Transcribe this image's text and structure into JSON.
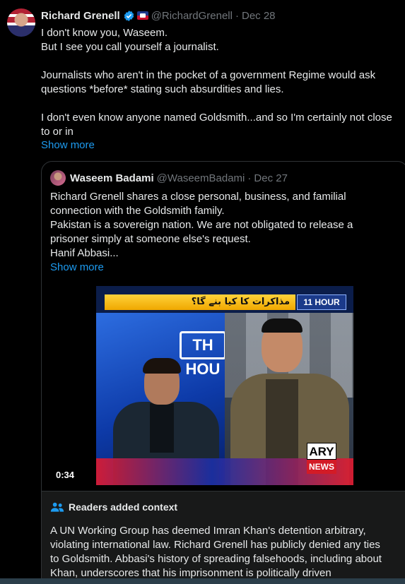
{
  "tweet": {
    "author_name": "Richard Grenell",
    "author_handle": "@RichardGrenell",
    "separator": "·",
    "date": "Dec 28",
    "lines": [
      "I don't know you, Waseem.",
      "But I see you call yourself a journalist.",
      "",
      "Journalists who aren't in the pocket of a government Regime would ask",
      "questions *before* stating such absurdities and lies.",
      "",
      "I don't even know anyone named Goldsmith...and so I'm certainly not close",
      "to or in"
    ],
    "show_more": "Show more"
  },
  "quote": {
    "author_name": "Waseem Badami",
    "author_handle": "@WaseemBadami",
    "separator": "·",
    "date": "Dec 27",
    "lines": [
      "Richard Grenell shares a close personal, business, and familial",
      "connection with the Goldsmith family.",
      "Pakistan is a sovereign nation. We are not obligated to release a",
      "prisoner simply at someone else's request.",
      "Hanif Abbasi..."
    ],
    "show_more": "Show more",
    "video": {
      "banner_text": "مذاکرات کا کیا بنے گا؟",
      "show_logo": "11 HOUR",
      "studio_sign": "TH HOU",
      "channel_top": "ARY",
      "channel_bottom": "NEWS",
      "duration": "0:34"
    }
  },
  "context": {
    "title": "Readers added context",
    "lines": [
      "A UN Working Group has deemed Imran Khan's detention arbitrary,",
      "violating international law. Richard Grenell has publicly denied any ties",
      "to Goldsmith. Abbasi's history of spreading falsehoods, including about",
      "Khan, underscores that his imprisonment is politically driven"
    ]
  },
  "colors": {
    "background": "#000000",
    "text": "#e7e9ea",
    "muted": "#71767b",
    "link": "#1d9bf0",
    "verified": "#1d9bf0"
  }
}
